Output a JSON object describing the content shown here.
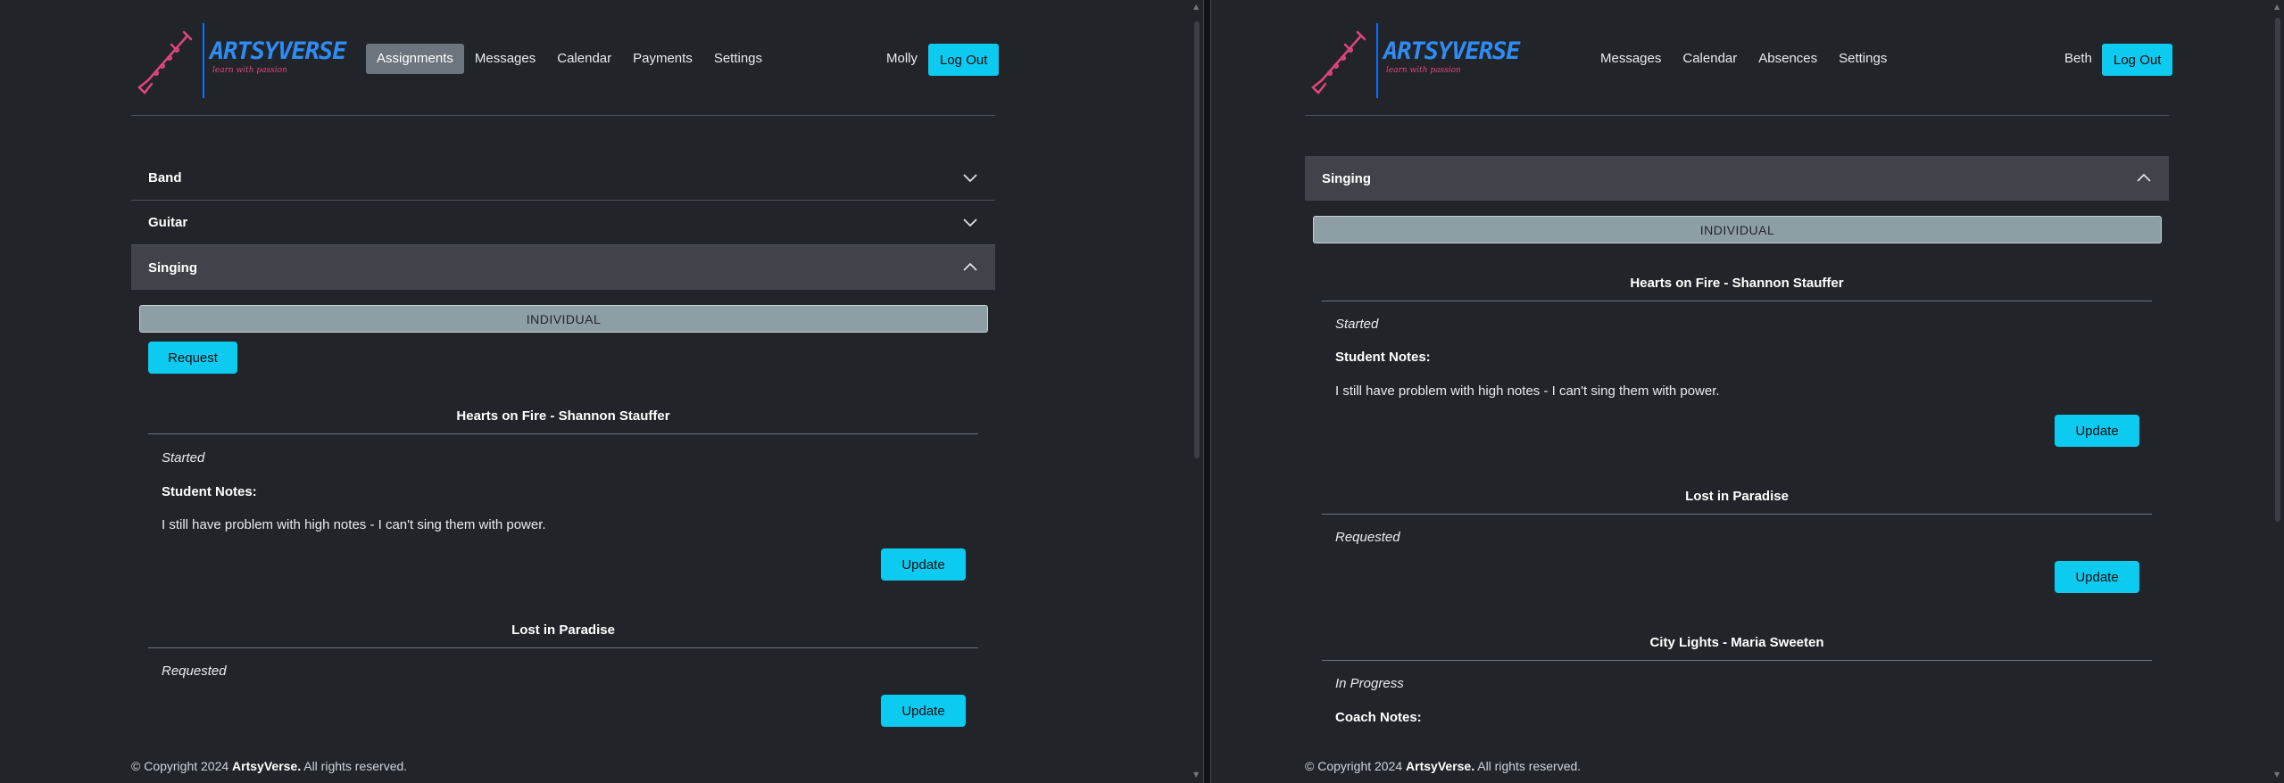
{
  "brand": {
    "name": "ARTSYVERSE",
    "tagline": "learn with passion"
  },
  "left": {
    "nav": [
      "Assignments",
      "Messages",
      "Calendar",
      "Payments",
      "Settings"
    ],
    "active_nav": "Assignments",
    "user": "Molly",
    "logout": "Log Out",
    "sections": [
      "Band",
      "Guitar",
      "Singing"
    ],
    "open_section": "Singing",
    "group_label": "INDIVIDUAL",
    "request_label": "Request",
    "songs": [
      {
        "title": "Hearts on Fire - Shannon Stauffer",
        "status": "Started",
        "notes_label": "Student Notes:",
        "notes": "I still have problem with high notes - I can't sing them with power.",
        "button": "Update"
      },
      {
        "title": "Lost in Paradise",
        "status": "Requested",
        "button": "Update"
      }
    ],
    "footer": {
      "prefix": "© Copyright 2024",
      "brand": "ArtsyVerse.",
      "suffix": "All rights reserved."
    }
  },
  "right": {
    "nav": [
      "Messages",
      "Calendar",
      "Absences",
      "Settings"
    ],
    "user": "Beth",
    "logout": "Log Out",
    "open_section": "Singing",
    "group_label": "INDIVIDUAL",
    "songs": [
      {
        "title": "Hearts on Fire - Shannon Stauffer",
        "status": "Started",
        "notes_label": "Student Notes:",
        "notes": "I still have problem with high notes - I can't sing them with power.",
        "button": "Update"
      },
      {
        "title": "Lost in Paradise",
        "status": "Requested",
        "button": "Update"
      },
      {
        "title": "City Lights - Maria Sweeten",
        "status": "In Progress",
        "notes_label": "Coach Notes:"
      }
    ],
    "footer": {
      "prefix": "© Copyright 2024",
      "brand": "ArtsyVerse.",
      "suffix": "All rights reserved."
    }
  },
  "colors": {
    "background": "#212529",
    "accent": "#0dcaf0",
    "brand_blue": "#2f8cf5",
    "brand_pink": "#e0457b",
    "open_section": "#40444a"
  },
  "icons": {
    "logo": "clarinet-icon",
    "collapsed": "chevron-down-icon",
    "expanded": "chevron-up-icon"
  }
}
